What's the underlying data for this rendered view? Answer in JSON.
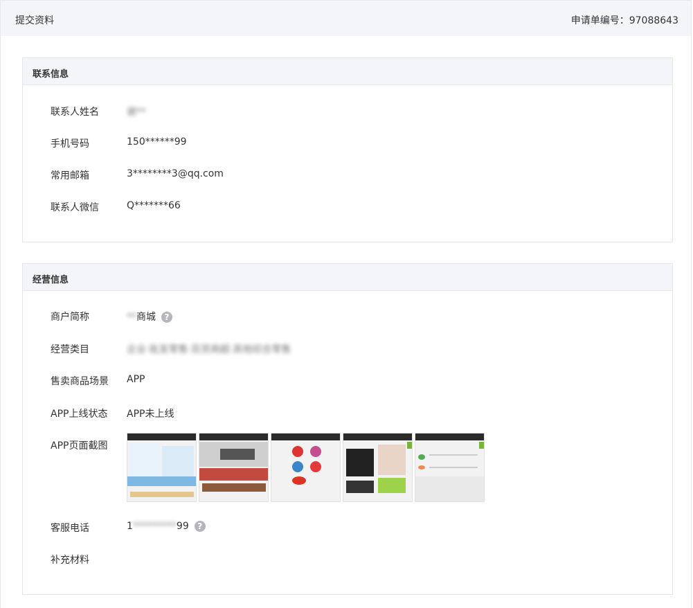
{
  "header": {
    "title": "提交资料",
    "application_number": "申请单编号：97088643"
  },
  "contact": {
    "section_title": "联系信息",
    "fields": [
      {
        "label": "联系人姓名",
        "value": "谢**"
      },
      {
        "label": "手机号码",
        "value": "150******99"
      },
      {
        "label": "常用邮箱",
        "value": "3********3@qq.com"
      },
      {
        "label": "联系人微信",
        "value": "Q*******66"
      }
    ]
  },
  "business": {
    "section_title": "经营信息",
    "merchant_name": {
      "label": "商户简称",
      "value_hidden": "**",
      "value_visible": "商城"
    },
    "category": {
      "label": "经营类目",
      "value": "企业·批发零售·百货商超·其他综合零售"
    },
    "sales_scene": {
      "label": "售卖商品场景",
      "value": "APP"
    },
    "app_status": {
      "label": "APP上线状态",
      "value": "APP未上线"
    },
    "app_screenshots": {
      "label": "APP页面截图",
      "images": [
        "screenshot-1",
        "screenshot-2",
        "screenshot-3",
        "screenshot-4",
        "screenshot-5"
      ]
    },
    "service_phone": {
      "label": "客服电话",
      "value_start": "1",
      "value_hidden": "*********",
      "value_end": "99"
    },
    "supplement": {
      "label": "补充材料",
      "value": ""
    }
  },
  "icons": {
    "help": "question-circle-icon"
  },
  "colors": {
    "header_bg": "#f4f5f9",
    "border": "#e3e5ea",
    "help_icon": "#b4b6bb"
  }
}
